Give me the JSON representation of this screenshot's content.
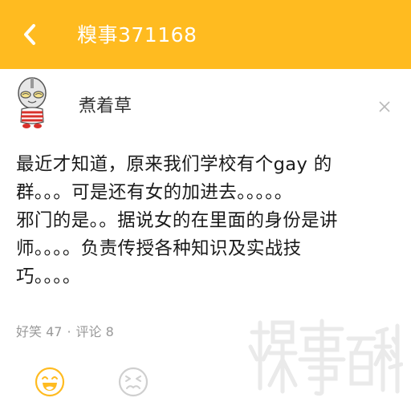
{
  "header": {
    "title": "糗事371168",
    "back_icon": "back-chevron-icon",
    "background": "#ffbb20"
  },
  "post": {
    "author": "煮着草",
    "avatar_icon": "ultraman-avatar-icon",
    "close_icon": "close-icon",
    "content": "最近才知道，原来我们学校有个gay 的\n群。。。可是还有女的加进去。。。。。\n邪门的是。。据说女的在里面的身份是讲\n师。。。。负责传授各种知识及实战技\n巧。。。。",
    "stats": {
      "funny_label": "好笑 47",
      "separator": "·",
      "comment_label": "评论 8"
    }
  },
  "reactions": {
    "like_icon": "laughing-face-icon",
    "dislike_icon": "frowning-face-icon",
    "like_color": "#ffbb20",
    "dislike_color": "#cfcfcf"
  },
  "watermark": {
    "text": "糗事百科"
  }
}
